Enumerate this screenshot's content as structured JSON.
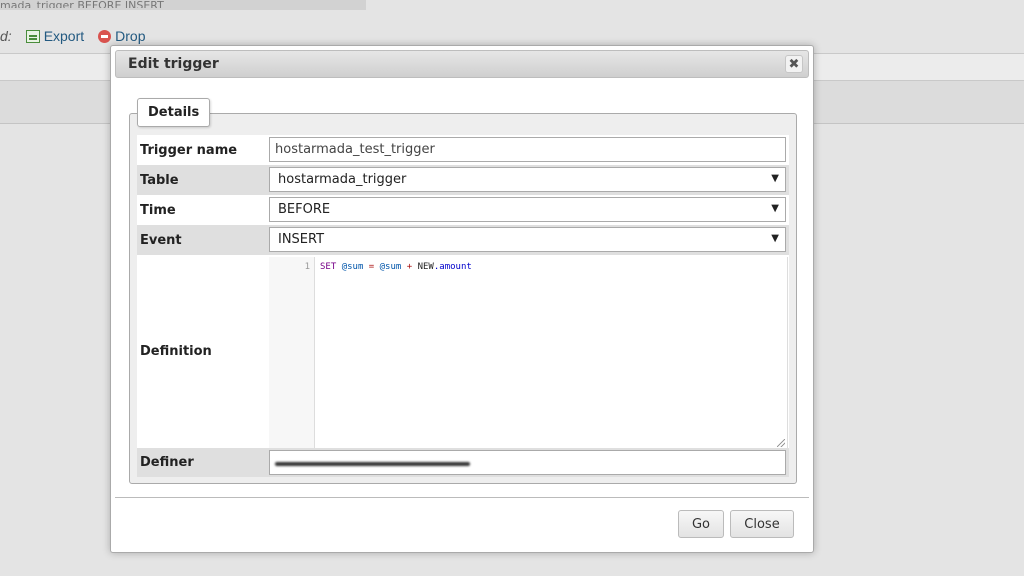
{
  "background": {
    "top_text": "mada_trigger    BEFORE INSERT",
    "actions_prefix": "d:",
    "export_label": "Export",
    "drop_label": "Drop"
  },
  "dialog": {
    "title": "Edit trigger",
    "close_symbol": "✖",
    "legend": "Details",
    "fields": {
      "trigger_name": {
        "label": "Trigger name",
        "value": "hostarmada_test_trigger"
      },
      "table": {
        "label": "Table",
        "value": "hostarmada_trigger"
      },
      "time": {
        "label": "Time",
        "value": "BEFORE"
      },
      "event": {
        "label": "Event",
        "value": "INSERT"
      },
      "definition": {
        "label": "Definition",
        "line_number": "1",
        "code": {
          "set": "SET",
          "var1": "@sum",
          "eq": "=",
          "var2": "@sum",
          "plus": "+",
          "new": "NEW",
          "dot_prop": ".amount"
        }
      },
      "definer": {
        "label": "Definer"
      }
    },
    "buttons": {
      "go": "Go",
      "close": "Close"
    }
  },
  "icons": {
    "close": "close-icon",
    "dropdown": "chevron-down-icon",
    "export": "export-icon",
    "drop": "drop-icon"
  }
}
